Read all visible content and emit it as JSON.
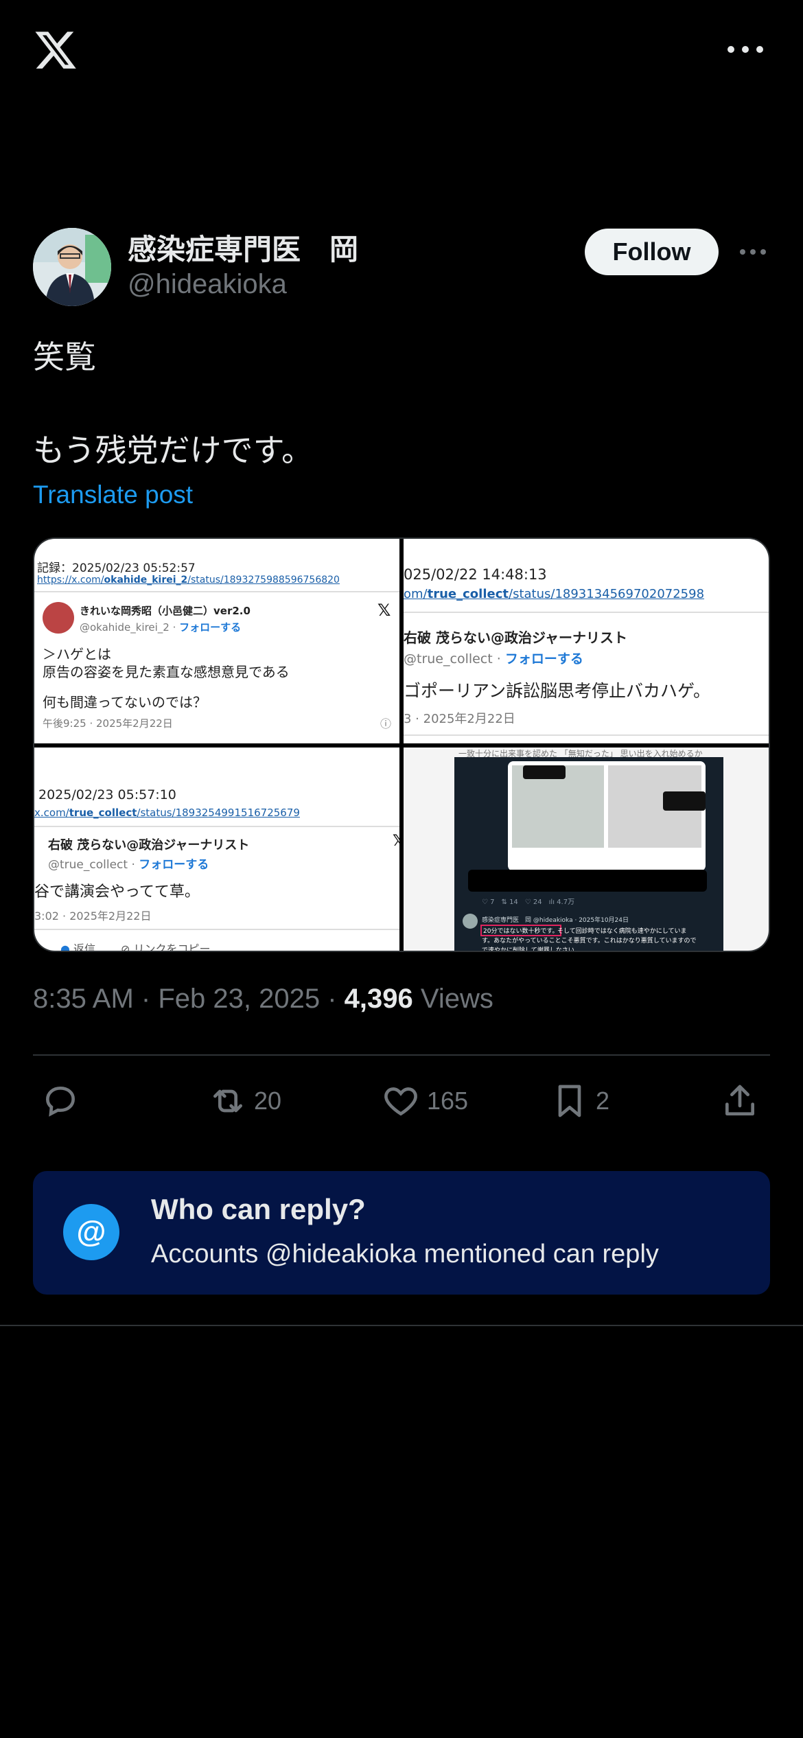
{
  "author": {
    "name": "感染症専門医　岡",
    "handle": "@hideakioka",
    "follow_label": "Follow"
  },
  "tweet": {
    "text": "笑覧\n\nもう残党だけです。",
    "translate_label": "Translate post"
  },
  "media": {
    "c1": {
      "record": "記録：2025/02/23 05:52:57",
      "url_prefix": "https://x.com/",
      "url_user": "okahide_kirei_2",
      "url_suffix": "/status/1893275988596756820",
      "name": "きれいな岡秀昭（小邑健二）ver2.0",
      "handle": "@okahide_kirei_2",
      "follow": "フォローする",
      "line1": "＞ハゲとは",
      "line2": "原告の容姿を見た素直な感想意見である",
      "line3": "何も間違ってないのでは？",
      "time": "午後9:25 · 2025年2月22日"
    },
    "c2": {
      "record": "025/02/22 14:48:13",
      "url_prefix": "om/",
      "url_user": "true_collect",
      "url_suffix": "/status/1893134569702072598",
      "name": "右破 茂らない@政治ジャーナリスト",
      "handle": "@true_collect",
      "follow": "フォローする",
      "body": "ゴポーリアン訴訟脳思考停止バカハゲ。",
      "time": "3 · 2025年2月22日"
    },
    "c3": {
      "record": "2025/02/23 05:57:10",
      "url_prefix": "x.com/",
      "url_user": "true_collect",
      "url_suffix": "/status/1893254991516725679",
      "name": "右破 茂らない@政治ジャーナリスト",
      "handle": "@true_collect",
      "follow": "フォローする",
      "body": "谷で講演会やってて草。",
      "time": "3:02 · 2025年2月22日",
      "reply": "返信",
      "copy": "リンクをコピー"
    },
    "c4": {
      "top": "一致十分に出来事を認めた 「無知だった」 思い出を入れ始めるか",
      "stats": "♡ 7　⇅ 14　♡ 24　ılı 4.7万",
      "poster": "感染症専門医　岡 @hideakioka · 2025年10月24日",
      "highlight": "20分ではない数十秒です。",
      "line1": "そして回診時ではなく病院も速やかにしていま",
      "line2": "す。あなたがやっていることこそ悪質です。これはかなり悪質していますので",
      "line3": "で速やかに削除して謝罪しなさい。"
    }
  },
  "meta": {
    "time": "8:35 AM",
    "date": "Feb 23, 2025",
    "sep": "·",
    "views_count": "4,396",
    "views_label": "Views"
  },
  "actions": {
    "retweets": "20",
    "likes": "165",
    "bookmarks": "2"
  },
  "who_can_reply": {
    "icon": "@",
    "title": "Who can reply?",
    "subtitle": "Accounts @hideakioka mentioned can reply"
  }
}
